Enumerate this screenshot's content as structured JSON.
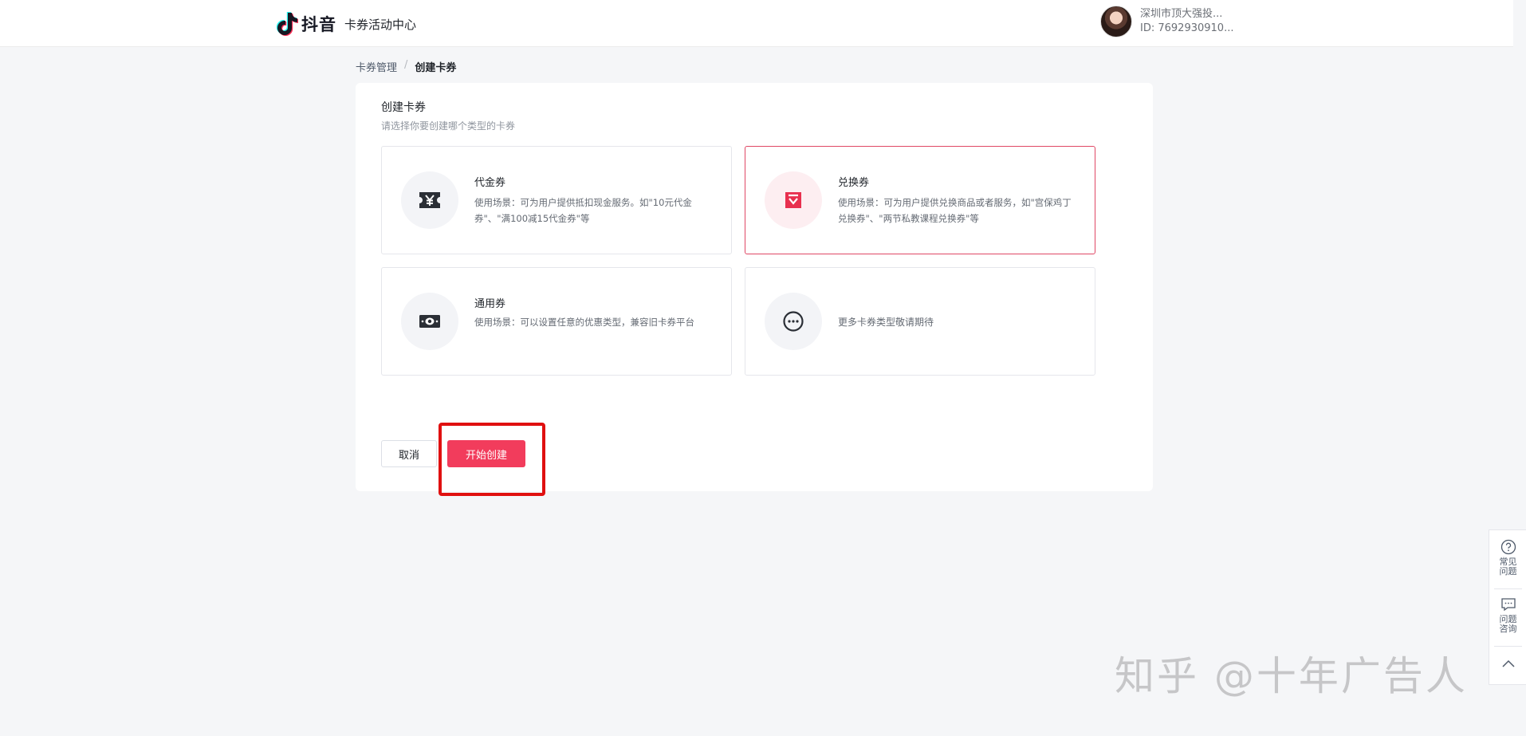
{
  "header": {
    "brand": "抖音",
    "subtitle": "卡券活动中心",
    "user_name": "深圳市顶大强投...",
    "user_id": "ID: 7692930910..."
  },
  "breadcrumb": {
    "parent": "卡券管理",
    "separator": "/",
    "current": "创建卡券"
  },
  "panel": {
    "title": "创建卡券",
    "subtitle": "请选择你要创建哪个类型的卡券"
  },
  "cards": [
    {
      "title": "代金券",
      "desc": "使用场景：可为用户提供抵扣现金服务。如\"10元代金券\"、\"满100减15代金券\"等",
      "icon": "cash-voucher-icon",
      "selected": false
    },
    {
      "title": "兑换券",
      "desc": "使用场景：可为用户提供兑换商品或者服务，如\"宫保鸡丁兑换券\"、\"两节私教课程兑换券\"等",
      "icon": "gift-box-icon",
      "selected": true
    },
    {
      "title": "通用券",
      "desc": "使用场景：可以设置任意的优惠类型，兼容旧卡券平台",
      "icon": "banknote-icon",
      "selected": false
    },
    {
      "title": "",
      "desc": "更多卡券类型敬请期待",
      "icon": "more-dots-icon",
      "selected": false
    }
  ],
  "actions": {
    "cancel": "取消",
    "create": "开始创建"
  },
  "float_bar": {
    "faq": "常见问题",
    "consult": "问题咨询"
  },
  "watermark": "知乎 @十年广告人",
  "colors": {
    "accent": "#f23c5c",
    "selected_border": "#e04865",
    "highlight": "#e01010"
  }
}
